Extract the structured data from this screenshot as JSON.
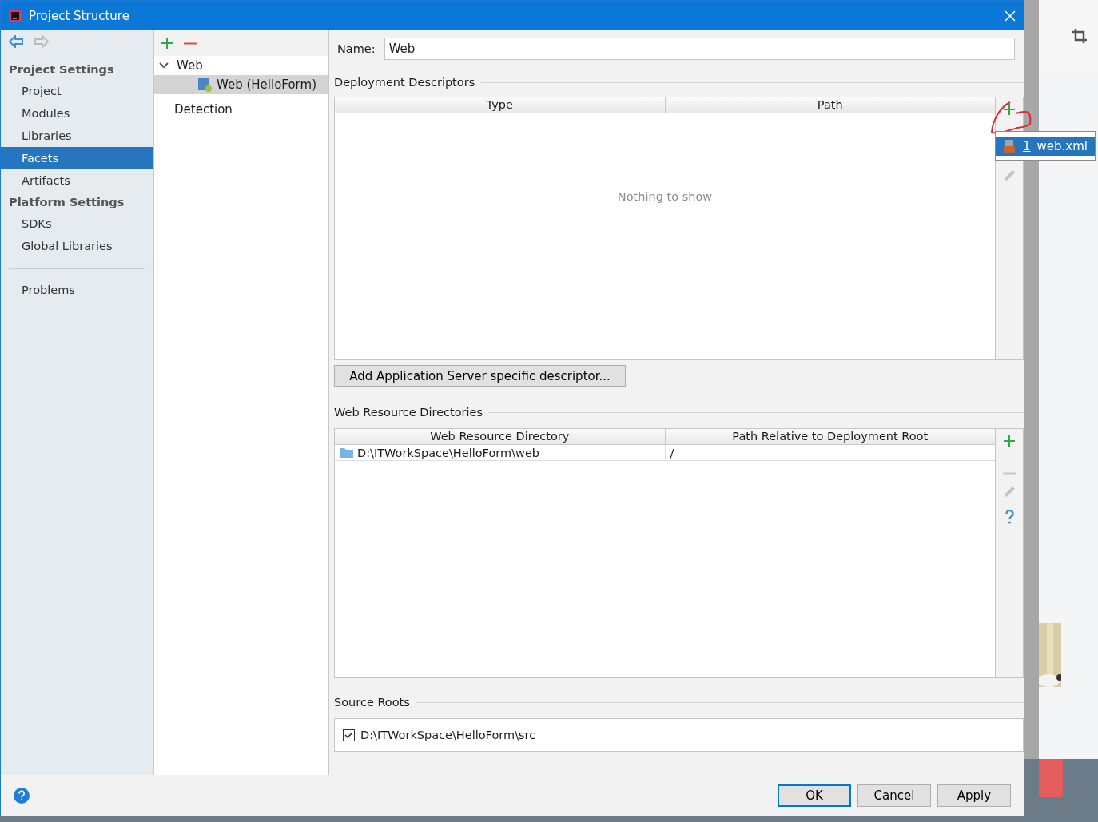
{
  "window": {
    "title": "Project Structure"
  },
  "sidebar": {
    "sections": [
      {
        "heading": "Project Settings",
        "items": [
          {
            "label": "Project",
            "selected": false
          },
          {
            "label": "Modules",
            "selected": false
          },
          {
            "label": "Libraries",
            "selected": false
          },
          {
            "label": "Facets",
            "selected": true
          },
          {
            "label": "Artifacts",
            "selected": false
          }
        ]
      },
      {
        "heading": "Platform Settings",
        "items": [
          {
            "label": "SDKs",
            "selected": false
          },
          {
            "label": "Global Libraries",
            "selected": false
          }
        ]
      }
    ],
    "extra_items": [
      {
        "label": "Problems",
        "selected": false
      }
    ]
  },
  "facets_tree": {
    "items": [
      {
        "label": "Web",
        "expanded": true,
        "selected": false,
        "children": [
          {
            "label": "Web (HelloForm)",
            "selected": true
          }
        ]
      }
    ],
    "detection": "Detection"
  },
  "name_field": {
    "label": "Name:",
    "value": "Web"
  },
  "deployment_descriptors": {
    "title": "Deployment Descriptors",
    "columns": [
      "Type",
      "Path"
    ],
    "empty_text": "Nothing to show",
    "add_menu": [
      {
        "number": "1",
        "label": "web.xml",
        "selected": true
      }
    ],
    "server_button": "Add Application Server specific descriptor..."
  },
  "web_resource_directories": {
    "title": "Web Resource Directories",
    "columns": [
      "Web Resource Directory",
      "Path Relative to Deployment Root"
    ],
    "rows": [
      {
        "cells": [
          "D:\\ITWorkSpace\\HelloForm\\web",
          "/"
        ]
      }
    ]
  },
  "source_roots": {
    "title": "Source Roots",
    "items": [
      {
        "path": "D:\\ITWorkSpace\\HelloForm\\src",
        "checked": true
      }
    ]
  },
  "buttons": [
    {
      "label": "OK",
      "default": true
    },
    {
      "label": "Cancel",
      "default": false
    },
    {
      "label": "Apply",
      "default": false
    }
  ]
}
